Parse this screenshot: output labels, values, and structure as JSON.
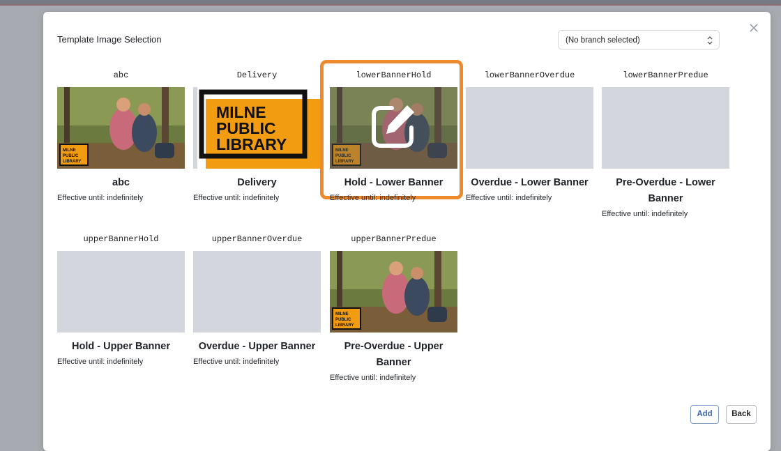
{
  "modal": {
    "title": "Template Image Selection",
    "branch_select": {
      "value": "(No branch selected)"
    },
    "actions": {
      "add_label": "Add",
      "back_label": "Back"
    }
  },
  "colors": {
    "selection_border": "#ee8a2e",
    "placeholder": "#d4d6dd",
    "library_logo_orange": "#f29c12"
  },
  "templates": [
    {
      "code": "abc",
      "title": "abc",
      "effective": "Effective until: indefinitely",
      "thumbnail": "photo-kids-forest"
    },
    {
      "code": "Delivery",
      "title": "Delivery",
      "effective": "Effective until: indefinitely",
      "thumbnail": "library-logo"
    },
    {
      "code": "lowerBannerHold",
      "title": "Hold - Lower Banner",
      "effective": "Effective until: indefinitely",
      "thumbnail": "photo-kids-forest",
      "selected": true,
      "overlay_icon": "edit-icon"
    },
    {
      "code": "lowerBannerOverdue",
      "title": "Overdue - Lower Banner",
      "effective": "Effective until: indefinitely",
      "thumbnail": "placeholder"
    },
    {
      "code": "lowerBannerPredue",
      "title": "Pre-Overdue - Lower Banner",
      "effective": "Effective until: indefinitely",
      "thumbnail": "placeholder"
    },
    {
      "code": "upperBannerHold",
      "title": "Hold - Upper Banner",
      "effective": "Effective until: indefinitely",
      "thumbnail": "placeholder"
    },
    {
      "code": "upperBannerOverdue",
      "title": "Overdue - Upper Banner",
      "effective": "Effective until: indefinitely",
      "thumbnail": "placeholder"
    },
    {
      "code": "upperBannerPredue",
      "title": "Pre-Overdue - Upper Banner",
      "effective": "Effective until: indefinitely",
      "thumbnail": "photo-kids-forest"
    }
  ],
  "logo_text": {
    "line1": "MILNE",
    "line2": "PUBLIC",
    "line3": "LIBRARY"
  }
}
